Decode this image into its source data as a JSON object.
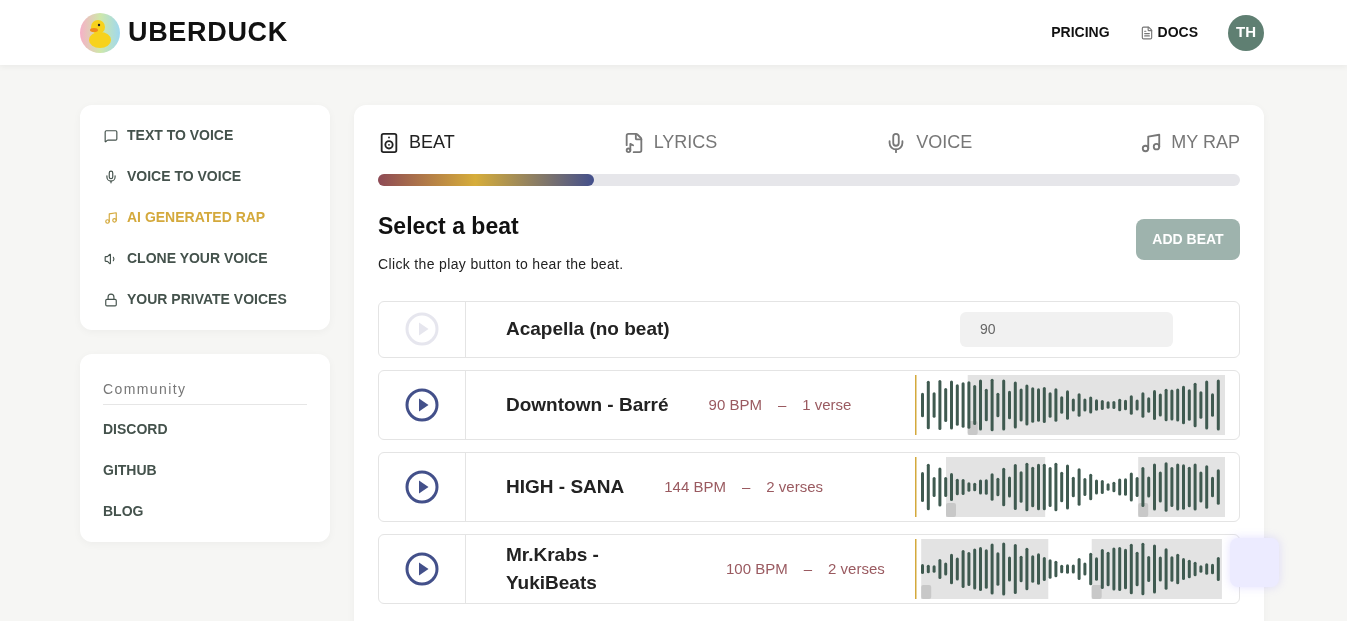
{
  "header": {
    "brand": "UBERDUCK",
    "links": [
      {
        "label": "PRICING"
      },
      {
        "label": "DOCS"
      }
    ],
    "avatar": "TH"
  },
  "sidebar": {
    "items": [
      {
        "label": "TEXT TO VOICE",
        "selected": false
      },
      {
        "label": "VOICE TO VOICE",
        "selected": false
      },
      {
        "label": "AI GENERATED RAP",
        "selected": true
      },
      {
        "label": "CLONE YOUR VOICE",
        "selected": false
      },
      {
        "label": "YOUR PRIVATE VOICES",
        "selected": false
      }
    ],
    "community": {
      "title": "Community",
      "links": [
        "DISCORD",
        "GITHUB",
        "BLOG"
      ]
    }
  },
  "steps": {
    "tabs": [
      {
        "label": "BEAT",
        "selected": true
      },
      {
        "label": "LYRICS",
        "selected": false
      },
      {
        "label": "VOICE",
        "selected": false
      },
      {
        "label": "MY RAP",
        "selected": false
      }
    ],
    "level": 0.25
  },
  "section": {
    "title": "Select a beat",
    "subtitle": "Click the play button to hear the beat.",
    "add_button": "ADD BEAT"
  },
  "beats": [
    {
      "kind": "acapella",
      "name": "Acapella (no beat)",
      "bpm_value": "90",
      "disabled": true
    },
    {
      "kind": "beat",
      "name": "Downtown - Barré",
      "bpm": "90 BPM",
      "dash": "–",
      "verses": "1 verse",
      "disabled": false
    },
    {
      "kind": "beat",
      "name": "HIGH - SANA",
      "bpm": "144 BPM",
      "dash": "–",
      "verses": "2 verses",
      "disabled": false
    },
    {
      "kind": "beat",
      "name": "Mr.Krabs - YukiBeats",
      "bpm": "100 BPM",
      "dash": "–",
      "verses": "2 verses",
      "disabled": false
    }
  ]
}
